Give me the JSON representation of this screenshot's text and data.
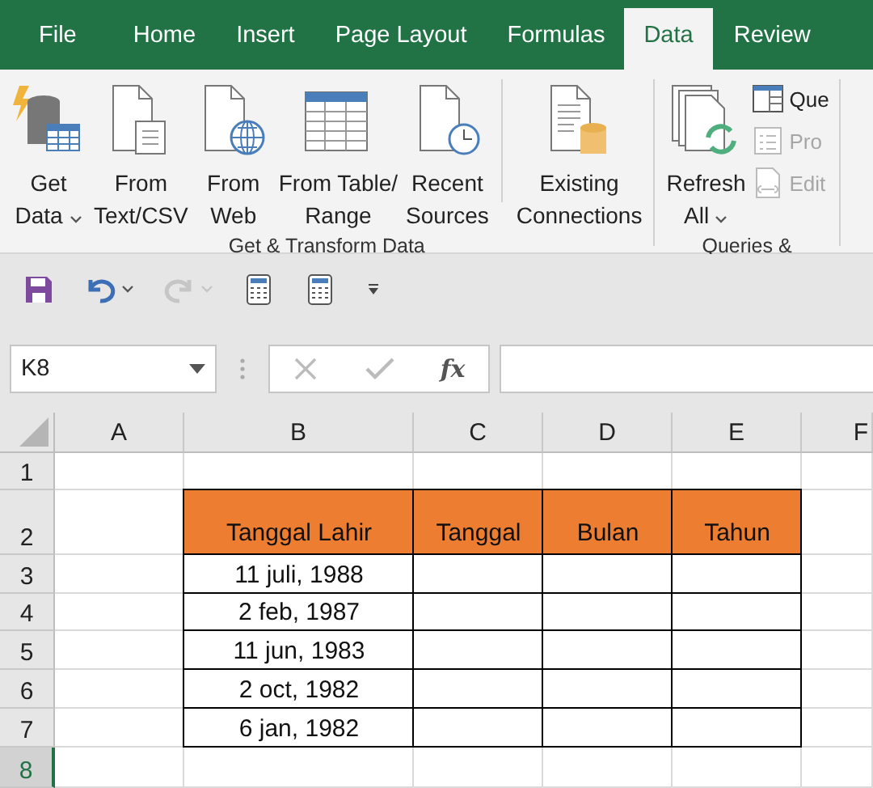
{
  "tabs": [
    {
      "label": "File",
      "selected": false
    },
    {
      "label": "Home",
      "selected": false
    },
    {
      "label": "Insert",
      "selected": false
    },
    {
      "label": "Page Layout",
      "selected": false
    },
    {
      "label": "Formulas",
      "selected": false
    },
    {
      "label": "Data",
      "selected": true
    },
    {
      "label": "Review",
      "selected": false
    }
  ],
  "ribbon": {
    "groups": [
      {
        "label": "Get & Transform Data",
        "buttons": [
          {
            "kind": "database",
            "lines": [
              "Get",
              "Data"
            ],
            "dropdown": true
          },
          {
            "kind": "text-file",
            "lines": [
              "From",
              "Text/CSV"
            ],
            "dropdown": false
          },
          {
            "kind": "web-file",
            "lines": [
              "From",
              "Web"
            ],
            "dropdown": false
          },
          {
            "kind": "table",
            "lines": [
              "From Table/",
              "Range"
            ],
            "dropdown": false
          },
          {
            "kind": "recent",
            "lines": [
              "Recent",
              "Sources"
            ],
            "dropdown": false
          },
          {
            "kind": "separator"
          },
          {
            "kind": "connections",
            "lines": [
              "Existing",
              "Connections"
            ],
            "dropdown": false
          }
        ]
      },
      {
        "label": "Queries &",
        "buttons": [
          {
            "kind": "refresh",
            "lines": [
              "Refresh",
              "All"
            ],
            "dropdown": true
          }
        ],
        "small_items": [
          {
            "kind": "queries",
            "label": "Que",
            "disabled": false
          },
          {
            "kind": "properties",
            "label": "Pro",
            "disabled": true
          },
          {
            "kind": "links",
            "label": "Edit",
            "disabled": true
          }
        ]
      }
    ]
  },
  "quick_access": [
    {
      "kind": "save",
      "disabled": false,
      "dropdown": false
    },
    {
      "kind": "undo",
      "disabled": false,
      "dropdown": true
    },
    {
      "kind": "redo",
      "disabled": true,
      "dropdown": true
    },
    {
      "kind": "calculator",
      "disabled": false,
      "dropdown": false
    },
    {
      "kind": "calculator",
      "disabled": false,
      "dropdown": false
    },
    {
      "kind": "customize",
      "disabled": false,
      "dropdown": false
    }
  ],
  "formula_bar": {
    "name_box": "K8",
    "function_label": "fx"
  },
  "sheet": {
    "columns": [
      {
        "label": "A"
      },
      {
        "label": "B"
      },
      {
        "label": "C"
      },
      {
        "label": "D"
      },
      {
        "label": "E"
      },
      {
        "label": "F"
      }
    ],
    "rows": [
      {
        "label": "1",
        "selected": false
      },
      {
        "label": "2",
        "selected": false
      },
      {
        "label": "3",
        "selected": false
      },
      {
        "label": "4",
        "selected": false
      },
      {
        "label": "5",
        "selected": false
      },
      {
        "label": "6",
        "selected": false
      },
      {
        "label": "7",
        "selected": false
      },
      {
        "label": "8",
        "selected": true
      }
    ],
    "table": {
      "headers": [
        "Tanggal Lahir",
        "Tanggal",
        "Bulan",
        "Tahun"
      ],
      "rows": [
        {
          "tanggal_lahir": "11 juli, 1988"
        },
        {
          "tanggal_lahir": "2 feb, 1987"
        },
        {
          "tanggal_lahir": "11 jun, 1983"
        },
        {
          "tanggal_lahir": "2 oct, 1982"
        },
        {
          "tanggal_lahir": "6 jan, 1982"
        }
      ]
    }
  }
}
